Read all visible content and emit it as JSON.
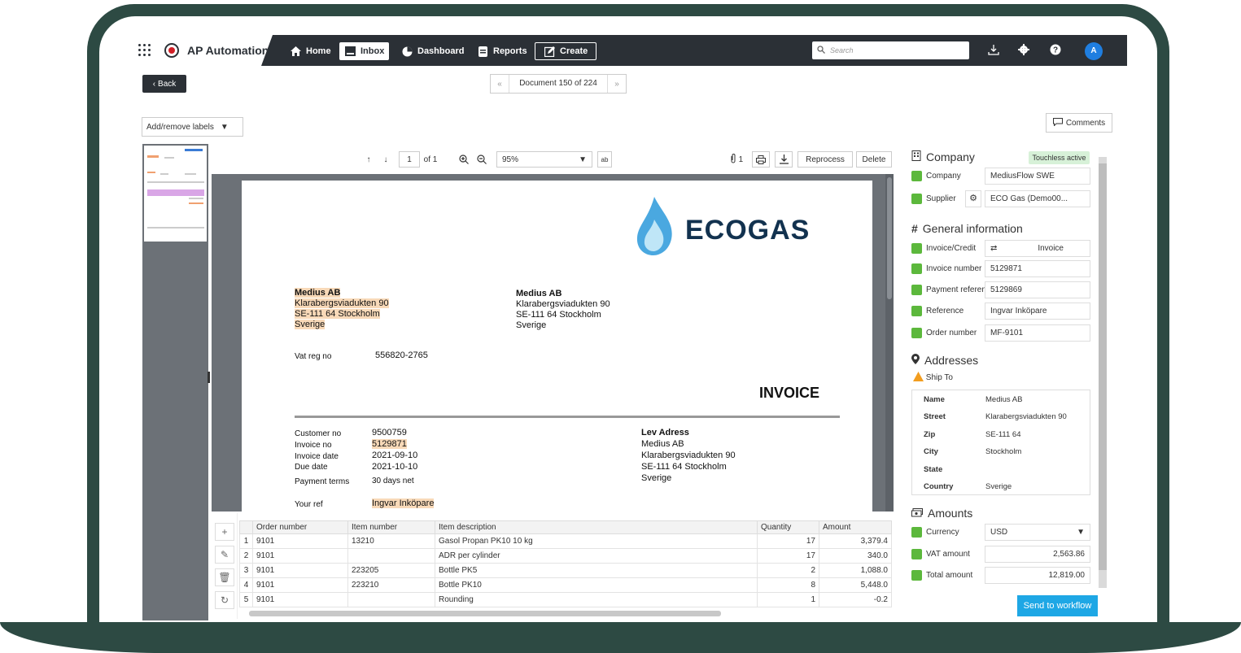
{
  "topbar": {
    "brand": "AP Automation",
    "nav": [
      "Home",
      "Inbox",
      "Dashboard",
      "Reports",
      "Create"
    ],
    "search_placeholder": "Search",
    "avatar": "A"
  },
  "subbar": {
    "back": "Back",
    "doc_position": "Document 150 of 224",
    "labels": "Add/remove labels",
    "comments": "Comments"
  },
  "viewer": {
    "page_num": "1",
    "page_of": "of 1",
    "zoom": "95%",
    "attachments": "1",
    "reprocess": "Reprocess",
    "delete": "Delete"
  },
  "invoice": {
    "logo": "ECOGAS",
    "sender": [
      "Medius AB",
      "Klarabergsviadukten 90",
      "SE-111 64 Stockholm",
      "Sverige"
    ],
    "recipient": [
      "Medius AB",
      "Klarabergsviadukten 90",
      "SE-111 64 Stockholm",
      "Sverige"
    ],
    "vat_label": "Vat reg no",
    "vat_value": "556820-2765",
    "title": "INVOICE",
    "meta_labels": [
      "Customer no",
      "Invoice no",
      "Invoice date",
      "Due date",
      "Payment terms"
    ],
    "meta_values": [
      "9500759",
      "5129871",
      "2021-09-10",
      "2021-10-10",
      "30 days net"
    ],
    "lev_title": "Lev Adress",
    "lev": [
      "Medius AB",
      "Klarabergsviadukten 90",
      "SE-111 64 Stockholm",
      "Sverige"
    ],
    "yourref_label": "Your ref",
    "yourref_value": "Ingvar Inköpare"
  },
  "lines": {
    "headers": [
      "Order number",
      "Item number",
      "Item description",
      "Quantity",
      "Amount"
    ],
    "rows": [
      [
        "1",
        "9101",
        "13210",
        "Gasol Propan PK10 10 kg",
        "17",
        "3,379.4"
      ],
      [
        "2",
        "9101",
        "",
        "ADR per cylinder",
        "17",
        "340.0"
      ],
      [
        "3",
        "9101",
        "223205",
        "Bottle PK5",
        "2",
        "1,088.0"
      ],
      [
        "4",
        "9101",
        "223210",
        "Bottle PK10",
        "8",
        "5,448.0"
      ],
      [
        "5",
        "9101",
        "",
        "Rounding",
        "1",
        "-0.2"
      ]
    ]
  },
  "panel": {
    "company_section": "Company",
    "touchless": "Touchless active",
    "company_label": "Company",
    "company_value": "MediusFlow SWE",
    "supplier_label": "Supplier",
    "supplier_value": "ECO Gas (Demo00...",
    "general_section": "General information",
    "fields": [
      {
        "label": "Invoice/Credit",
        "value": "Invoice"
      },
      {
        "label": "Invoice number",
        "value": "5129871"
      },
      {
        "label": "Payment referenc",
        "value": "5129869"
      },
      {
        "label": "Reference",
        "value": "Ingvar Inköpare"
      },
      {
        "label": "Order number",
        "value": "MF-9101"
      }
    ],
    "addresses_section": "Addresses",
    "ship_to": "Ship To",
    "address": [
      {
        "k": "Name",
        "v": "Medius AB"
      },
      {
        "k": "Street",
        "v": "Klarabergsviadukten 90"
      },
      {
        "k": "Zip",
        "v": "SE-111 64"
      },
      {
        "k": "City",
        "v": "Stockholm"
      },
      {
        "k": "State",
        "v": ""
      },
      {
        "k": "Country",
        "v": "Sverige"
      }
    ],
    "amounts_section": "Amounts",
    "currency_label": "Currency",
    "currency_value": "USD",
    "vat_label": "VAT amount",
    "vat_value": "2,563.86",
    "total_label": "Total amount",
    "total_value": "12,819.00",
    "send": "Send to workflow"
  },
  "colors": {
    "topbar": "#2b3036",
    "accent": "#1ea7e5",
    "ok": "#5cb83c",
    "highlight": "#f8d9b8"
  }
}
